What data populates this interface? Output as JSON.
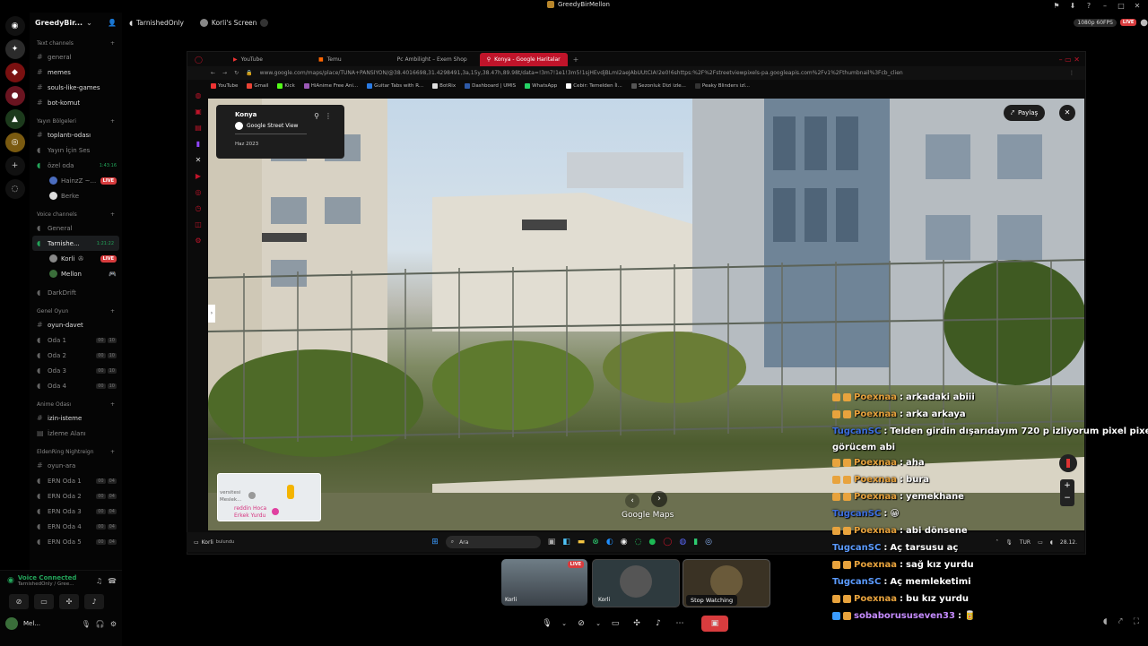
{
  "app": {
    "title": "GreedyBirMellon"
  },
  "server": {
    "name": "GreedyBir..."
  },
  "topbar": {
    "channel": "TarnishedOnly",
    "screen": "Korli's Screen",
    "quality": "1080p 60FPS",
    "live": "LIVE"
  },
  "sidebar": {
    "text_cat": "Text channels",
    "text_channels": [
      "general",
      "memes",
      "souls-like-games",
      "bot-komut"
    ],
    "stage_cat": "Yayın Bölgeleri",
    "stage_channels": [
      "toplantı-odası",
      "Yayın İçin Ses",
      "özel oda"
    ],
    "ozel_time": "1:43:16",
    "ozel_users": [
      "HainzZ ~...",
      "Berke"
    ],
    "voice_cat": "Voice channels",
    "voice_general": "General",
    "tarnished": {
      "name": "Tarnishe...",
      "time": "1:21:22"
    },
    "tarnished_users": [
      "Korli",
      "Mellon"
    ],
    "darkdrift": "DarkDrift",
    "game_cat": "Genel Oyun",
    "game_text": "oyun-davet",
    "game_rooms": [
      "Oda 1",
      "Oda 2",
      "Oda 3",
      "Oda 4"
    ],
    "room_counts": [
      "00",
      "10"
    ],
    "anime_cat": "Anime Odası",
    "anime_text": "izin-isteme",
    "anime_voice": "İzleme Alanı",
    "elden_cat": "EldenRing Nightreign",
    "elden_text": "oyun-ara",
    "elden_rooms": [
      "ERN Oda 1",
      "ERN Oda 2",
      "ERN Oda 3",
      "ERN Oda 4",
      "ERN Oda 5"
    ],
    "elden_counts": [
      "00",
      "04"
    ]
  },
  "voice_panel": {
    "status": "Voice Connected",
    "sub": "TarnishedOnly / Gree...",
    "user": "Mel..."
  },
  "browser": {
    "tabs": [
      "YouTube",
      "Temu",
      "Pc Ambilight – Exem Shop",
      "Konya - Google Haritalar"
    ],
    "url": "www.google.com/maps/place/TUNA+PANSİYON/@38.4016698,31.4298491,3a,15y,38.47h,89.98t/data=!3m7!1e1!3m5!1sjHEvdjBLmI2aeJAbUUtCIA!2e0!6shttps:%2F%2Fstreetviewpixels-pa.googleapis.com%2Fv1%2Fthumbnail%3Fcb_clien",
    "bookmarks": [
      "YouTube",
      "Gmail",
      "Kick",
      "HiAnime Free Ani...",
      "Guitar Tabs with R...",
      "BotRix",
      "Dashboard | UMIS",
      "WhatsApp",
      "Cebir: Temelden İl...",
      "Sezonluk Dizi izle...",
      "Peaky Blinders izl..."
    ]
  },
  "streetview": {
    "place": "Konya",
    "source": "Google Street View",
    "date": "Haz 2023",
    "share": "Paylaş",
    "watermark": "Google Maps",
    "map_labels": [
      "versitesi",
      "Meslek...",
      "reddin Hoca",
      "Erkek Yurdu"
    ]
  },
  "taskbar": {
    "search": "Ara",
    "lang": "TUR",
    "clock": "28.12.",
    "stream_user": "Korli",
    "found": "bulundu"
  },
  "chat": [
    {
      "user": "Poexnaa",
      "msg": "arkadaki abiii",
      "color": "#e8a33d"
    },
    {
      "user": "Poexnaa",
      "msg": "arka arkaya",
      "color": "#e8a33d"
    },
    {
      "user": "TugcanSC",
      "msg": "Telden girdin dışarıdayım 720 p izliyorum pixel pixel nasıl",
      "color": "#3d6fe0",
      "cont": "görücem abi"
    },
    {
      "user": "Poexnaa",
      "msg": "aha",
      "color": "#e8a33d"
    },
    {
      "user": "Poexnaa",
      "msg": "bura",
      "color": "#e8a33d"
    },
    {
      "user": "Poexnaa",
      "msg": "yemekhane",
      "color": "#e8a33d"
    },
    {
      "user": "TugcanSC",
      "msg": "😀",
      "color": "#3d6fe0"
    },
    {
      "user": "Poexnaa",
      "msg": "abi dönsene",
      "color": "#e8a33d"
    },
    {
      "user": "TugcanSC",
      "msg": "Aç tarsusu aç",
      "color": "#5b9bff"
    },
    {
      "user": "Poexnaa",
      "msg": "sağ kız yurdu",
      "color": "#e8a33d"
    },
    {
      "user": "TugcanSC",
      "msg": "Aç memleketimi",
      "color": "#5b9bff"
    },
    {
      "user": "Poexnaa",
      "msg": "bu kız yurdu",
      "color": "#e8a33d"
    },
    {
      "user": "sobaborususeven33",
      "msg": "🥫",
      "color": "#c58bff"
    }
  ],
  "participants": {
    "tile1": "Korli",
    "tile1_badge": "LIVE",
    "tile2": "Korli",
    "tooltip": "Stop Watching"
  },
  "colors": {
    "live": "#d83c3e",
    "green": "#23a55a",
    "browser_accent": "#c0142a"
  }
}
